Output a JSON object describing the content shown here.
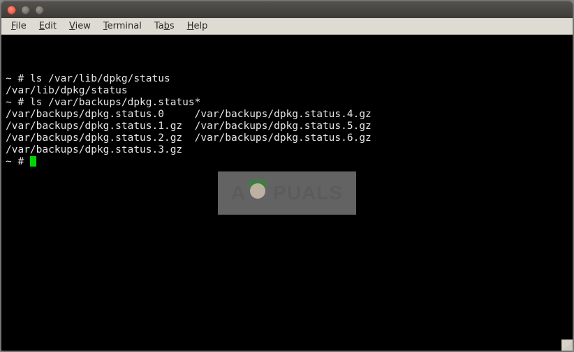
{
  "menubar": {
    "file": "File",
    "edit": "Edit",
    "view": "View",
    "terminal": "Terminal",
    "tabs": "Tabs",
    "help": "Help"
  },
  "terminal": {
    "lines": [
      "~ # ls /var/lib/dpkg/status",
      "/var/lib/dpkg/status",
      "~ # ls /var/backups/dpkg.status*",
      "/var/backups/dpkg.status.0     /var/backups/dpkg.status.4.gz",
      "/var/backups/dpkg.status.1.gz  /var/backups/dpkg.status.5.gz",
      "/var/backups/dpkg.status.2.gz  /var/backups/dpkg.status.6.gz",
      "/var/backups/dpkg.status.3.gz"
    ],
    "prompt": "~ # "
  },
  "watermark": {
    "prefix": "A",
    "suffix": "PUALS"
  }
}
